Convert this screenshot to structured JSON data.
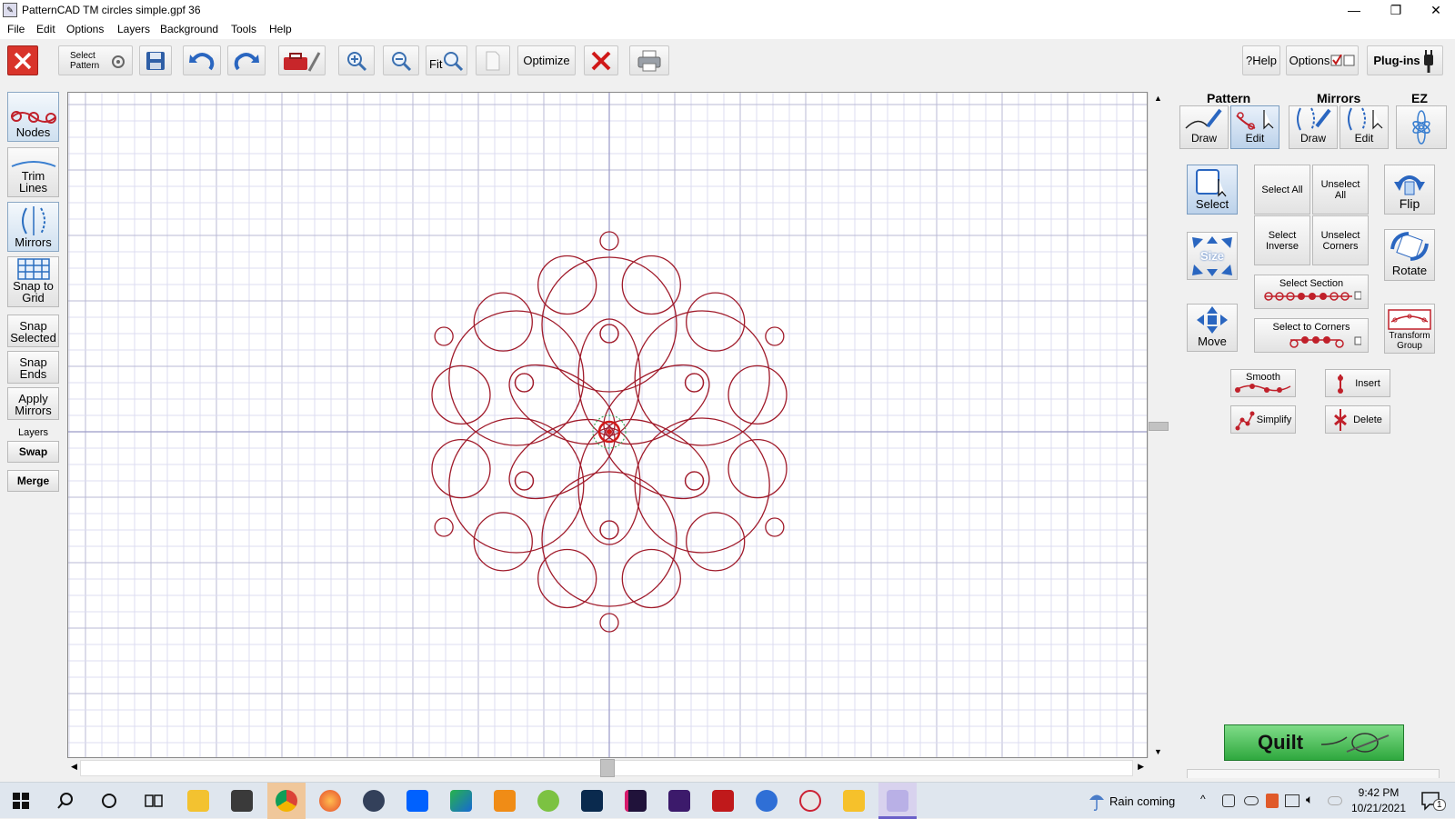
{
  "window": {
    "title": "PatternCAD TM   circles simple.gpf 36",
    "minimize": "—",
    "restore": "❐",
    "close": "✕"
  },
  "menu": [
    "File",
    "Edit",
    "Options",
    "Layers",
    "Background",
    "Tools",
    "Help"
  ],
  "toolbar": {
    "select_pattern_line1": "Select",
    "select_pattern_line2": "Pattern",
    "fit_label": "Fit",
    "optimize_label": "Optimize",
    "help_label": "Help",
    "options_label": "Options",
    "plugins_label": "Plug-ins"
  },
  "left_panel": {
    "nodes": "Nodes",
    "trim_lines_1": "Trim",
    "trim_lines_2": "Lines",
    "mirrors": "Mirrors",
    "snap_grid_1": "Snap to",
    "snap_grid_2": "Grid",
    "snap_selected_1": "Snap",
    "snap_selected_2": "Selected",
    "snap_ends_1": "Snap",
    "snap_ends_2": "Ends",
    "apply_mirrors_1": "Apply",
    "apply_mirrors_2": "Mirrors",
    "layers_label": "Layers",
    "swap": "Swap",
    "merge": "Merge"
  },
  "right_panel": {
    "pattern_header": "Pattern",
    "mirrors_header": "Mirrors",
    "ez_header": "EZ",
    "draw": "Draw",
    "edit": "Edit",
    "mirrors_draw": "Draw",
    "mirrors_edit": "Edit",
    "select": "Select",
    "select_all": "Select All",
    "unselect_all_1": "Unselect",
    "unselect_all_2": "All",
    "flip": "Flip",
    "size": "Size",
    "select_inverse_1": "Select",
    "select_inverse_2": "Inverse",
    "unselect_corners_1": "Unselect",
    "unselect_corners_2": "Corners",
    "rotate": "Rotate",
    "select_section": "Select Section",
    "move": "Move",
    "select_to_corners": "Select to Corners",
    "transform_group_1": "Transform",
    "transform_group_2": "Group",
    "smooth": "Smooth",
    "insert": "Insert",
    "simplify": "Simplify",
    "delete": "Delete",
    "quilt": "Quilt"
  },
  "taskbar": {
    "weather": "Rain coming",
    "time": "9:42 PM",
    "date": "10/21/2021",
    "notification_count": "1"
  },
  "colors": {
    "pattern_stroke": "#a01a2a",
    "grid_minor": "#dcdcf0",
    "grid_major": "#b8b8d4",
    "quilt_green": "#3cb44a",
    "accent_blue": "#3f7ec8"
  }
}
